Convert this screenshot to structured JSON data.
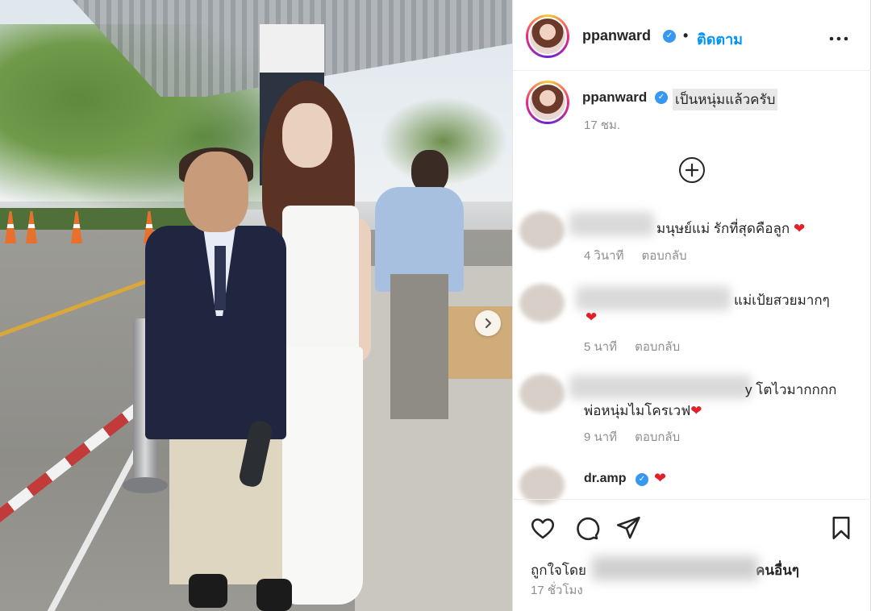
{
  "post": {
    "author": "ppanward",
    "separator": "•",
    "follow_label": "ติดตาม",
    "more_icon": "more-horizontal-icon",
    "caption": "เป็นหนุ่มแล้วครับ",
    "caption_time": "17 ชม.",
    "load_more_icon": "plus-circle-icon",
    "next_icon": "chevron-right-icon"
  },
  "comments": [
    {
      "text": "มนุษย์แม่ รักที่สุดคือลูก",
      "emoji": "❤",
      "time": "4 วินาที",
      "reply": "ตอบกลับ"
    },
    {
      "text": "แม่เป้ยสวยมากๆ",
      "emoji": "❤",
      "time": "5 นาที",
      "reply": "ตอบกลับ"
    },
    {
      "text_line1": "y โตไวมากกกก",
      "text_line2": "พ่อหนุ่มไมโครเวฟ",
      "emoji": "❤",
      "time": "9 นาที",
      "reply": "ตอบกลับ"
    },
    {
      "username": "dr.amp",
      "emoji": "❤"
    }
  ],
  "actions": {
    "like_icon": "heart-icon",
    "comment_icon": "comment-icon",
    "share_icon": "send-icon",
    "save_icon": "bookmark-icon"
  },
  "likes": {
    "prefix": "ถูกใจโดย",
    "suffix": "คนอื่นๆ"
  },
  "post_time": "17 ชั่วโมง",
  "colors": {
    "link_blue": "#0095f6",
    "verified_blue": "#3897f0",
    "heart_red": "#e0202b",
    "muted_text": "#8e8e8e"
  }
}
